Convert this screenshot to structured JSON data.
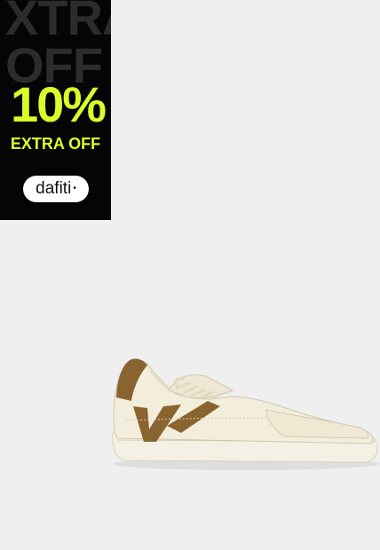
{
  "promo": {
    "ghost_line1": "XTRA",
    "ghost_line2": "OFF",
    "discount": "10%",
    "extra_off": "EXTRA OFF",
    "brand": "dafiti",
    "brand_dot": "•",
    "accent_color": "#d9ff2b",
    "background_color": "#050505"
  },
  "product": {
    "image_icon": "sneaker-image",
    "colors": {
      "base": "#f2eedb",
      "accent": "#8a6430",
      "sole": "#f4f0e4",
      "background": "#efefef"
    }
  }
}
